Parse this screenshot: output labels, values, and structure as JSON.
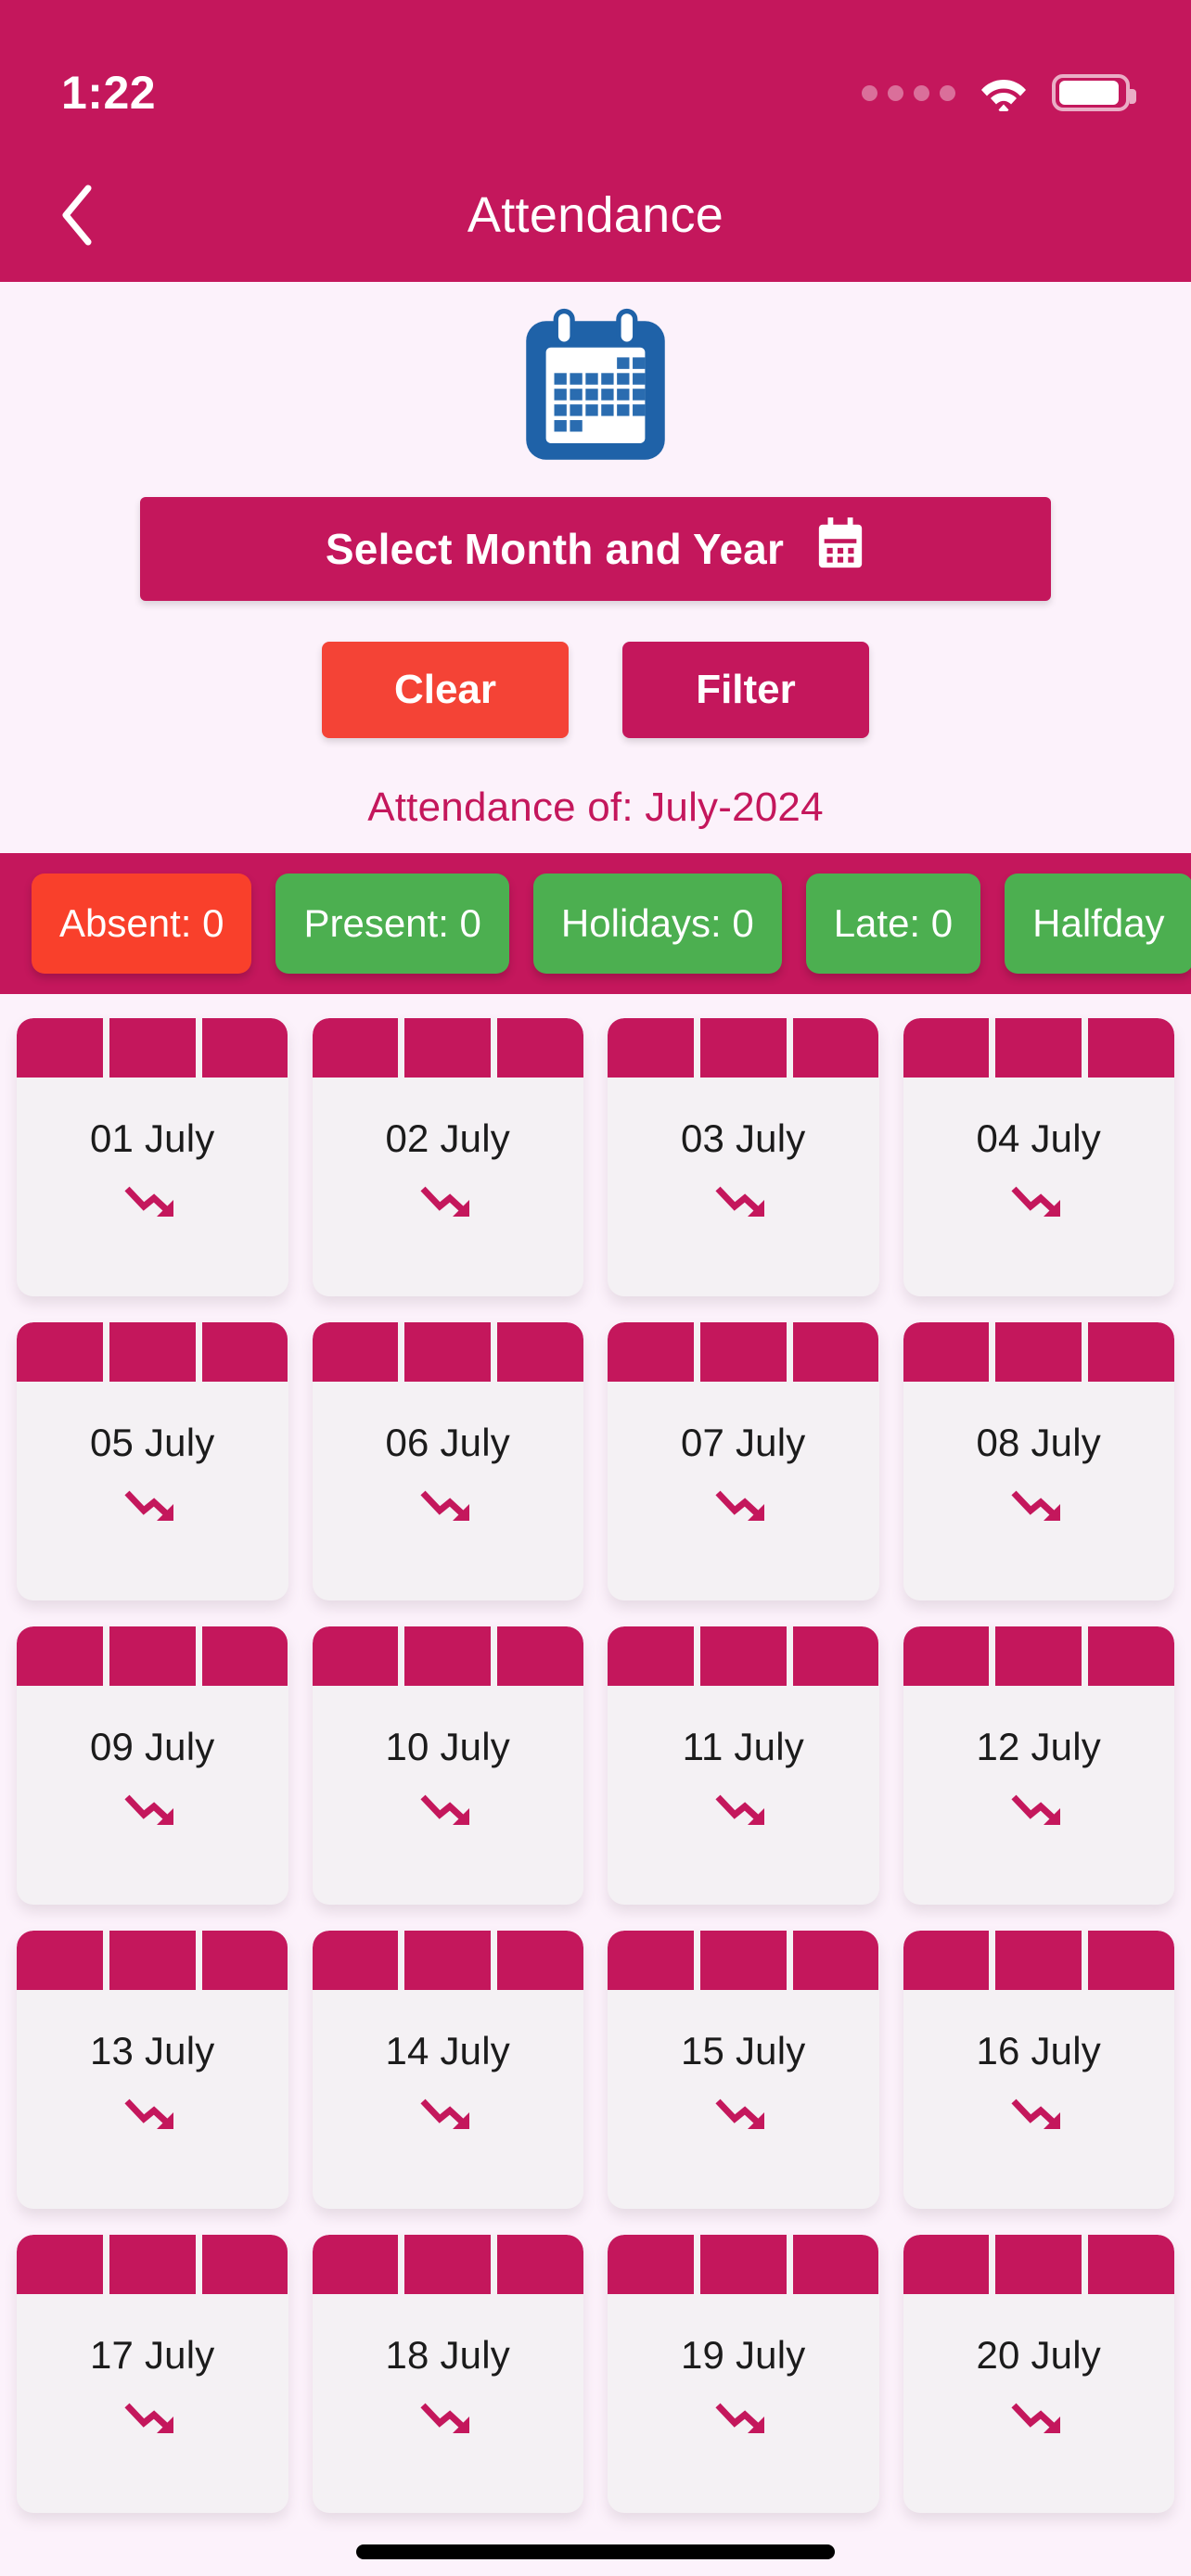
{
  "statusbar": {
    "time": "1:22",
    "signal_icon": "signal-dots-icon",
    "wifi_icon": "wifi-icon",
    "battery_icon": "battery-full-icon"
  },
  "appbar": {
    "title": "Attendance",
    "back_icon": "chevron-left-icon"
  },
  "filter": {
    "calendar_illustration": "calendar-icon",
    "select_label": "Select Month and Year",
    "select_icon": "calendar-small-icon",
    "clear_label": "Clear",
    "filter_label": "Filter",
    "attendance_of": "Attendance of: July-2024"
  },
  "stats": {
    "chips": [
      {
        "label": "Absent: 0",
        "color": "#F9402B"
      },
      {
        "label": "Present: 0",
        "color": "#4CAF50"
      },
      {
        "label": "Holidays: 0",
        "color": "#4CAF50"
      },
      {
        "label": "Late: 0",
        "color": "#4CAF50"
      },
      {
        "label": "Halfday",
        "color": "#4CAF50"
      }
    ]
  },
  "days": [
    {
      "date": "01 July",
      "status_icon": "trending-down-icon"
    },
    {
      "date": "02 July",
      "status_icon": "trending-down-icon"
    },
    {
      "date": "03 July",
      "status_icon": "trending-down-icon"
    },
    {
      "date": "04 July",
      "status_icon": "trending-down-icon"
    },
    {
      "date": "05 July",
      "status_icon": "trending-down-icon"
    },
    {
      "date": "06 July",
      "status_icon": "trending-down-icon"
    },
    {
      "date": "07 July",
      "status_icon": "trending-down-icon"
    },
    {
      "date": "08 July",
      "status_icon": "trending-down-icon"
    },
    {
      "date": "09 July",
      "status_icon": "trending-down-icon"
    },
    {
      "date": "10 July",
      "status_icon": "trending-down-icon"
    },
    {
      "date": "11 July",
      "status_icon": "trending-down-icon"
    },
    {
      "date": "12 July",
      "status_icon": "trending-down-icon"
    },
    {
      "date": "13 July",
      "status_icon": "trending-down-icon"
    },
    {
      "date": "14 July",
      "status_icon": "trending-down-icon"
    },
    {
      "date": "15 July",
      "status_icon": "trending-down-icon"
    },
    {
      "date": "16 July",
      "status_icon": "trending-down-icon"
    },
    {
      "date": "17 July",
      "status_icon": "trending-down-icon"
    },
    {
      "date": "18 July",
      "status_icon": "trending-down-icon"
    },
    {
      "date": "19 July",
      "status_icon": "trending-down-icon"
    },
    {
      "date": "20 July",
      "status_icon": "trending-down-icon"
    }
  ],
  "colors": {
    "brand_crimson": "#C4175C",
    "clear_orange": "#F44336",
    "chip_red": "#F9402B",
    "chip_green": "#4CAF50",
    "page_bg": "#FCF2FB",
    "card_bg": "#F4F1F4",
    "calendar_blue": "#1F62A8"
  }
}
